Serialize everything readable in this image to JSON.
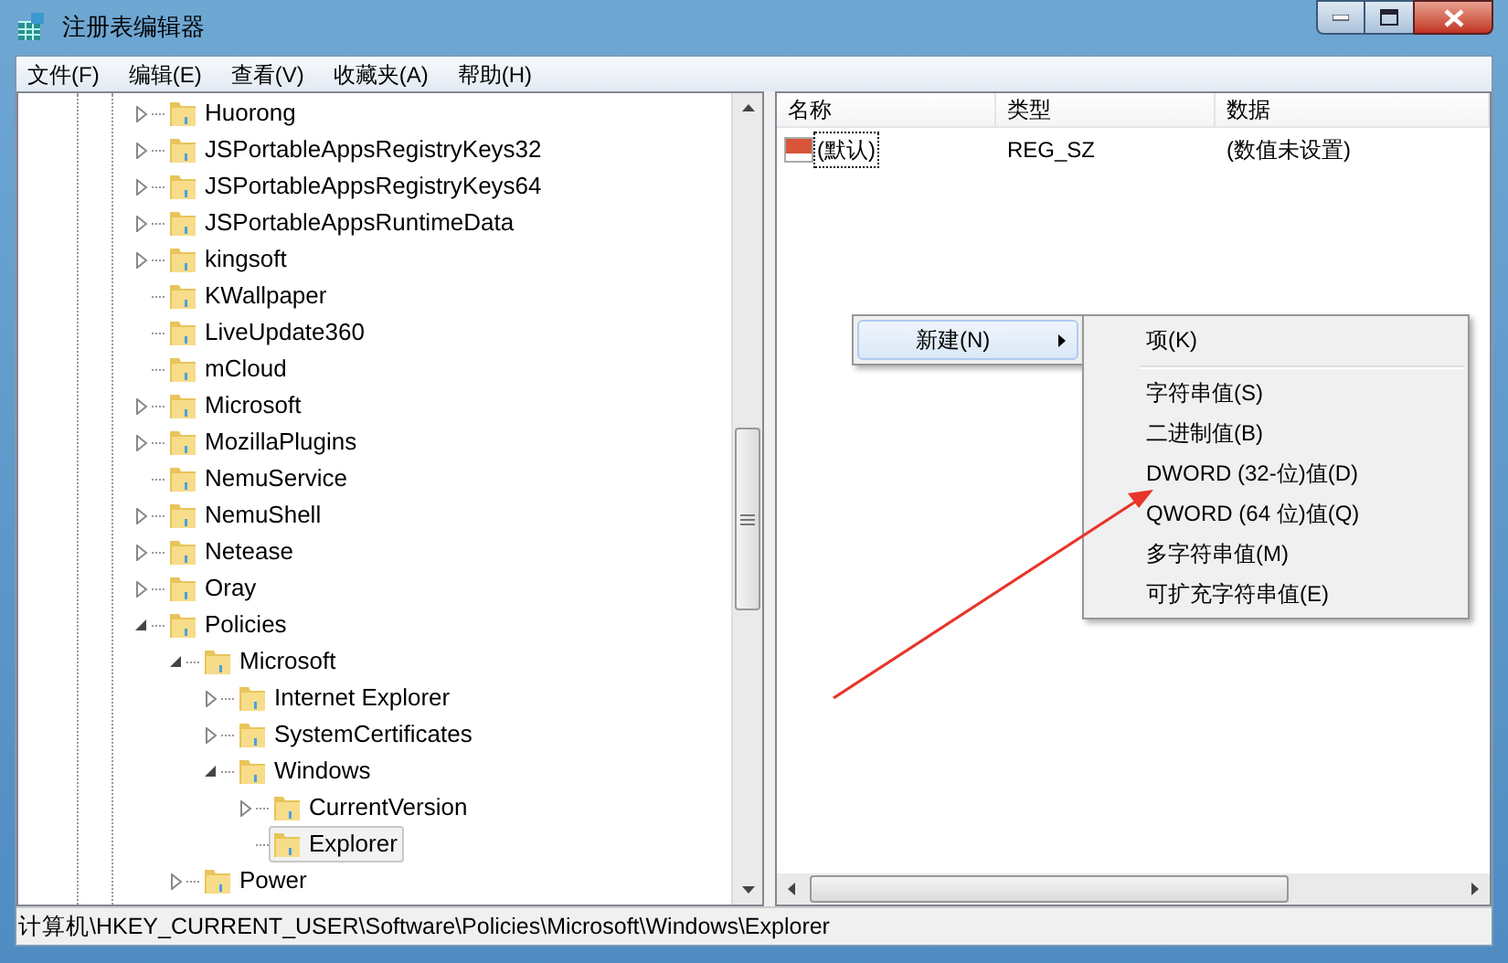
{
  "window": {
    "title": "注册表编辑器"
  },
  "menu_bar": [
    "文件(F)",
    "编辑(E)",
    "查看(V)",
    "收藏夹(A)",
    "帮助(H)"
  ],
  "tree": [
    {
      "label": "Huorong",
      "kind": "collapsed",
      "selected": false
    },
    {
      "label": "JSPortableAppsRegistryKeys32",
      "kind": "collapsed",
      "selected": false
    },
    {
      "label": "JSPortableAppsRegistryKeys64",
      "kind": "collapsed",
      "selected": false
    },
    {
      "label": "JSPortableAppsRuntimeData",
      "kind": "collapsed",
      "selected": false
    },
    {
      "label": "kingsoft",
      "kind": "collapsed",
      "selected": false
    },
    {
      "label": "KWallpaper",
      "kind": "leaf",
      "selected": false
    },
    {
      "label": "LiveUpdate360",
      "kind": "leaf",
      "selected": false
    },
    {
      "label": "mCloud",
      "kind": "leaf",
      "selected": false
    },
    {
      "label": "Microsoft",
      "kind": "collapsed",
      "selected": false
    },
    {
      "label": "MozillaPlugins",
      "kind": "collapsed",
      "selected": false
    },
    {
      "label": "NemuService",
      "kind": "leaf",
      "selected": false
    },
    {
      "label": "NemuShell",
      "kind": "collapsed",
      "selected": false
    },
    {
      "label": "Netease",
      "kind": "collapsed",
      "selected": false
    },
    {
      "label": "Oray",
      "kind": "collapsed",
      "selected": false
    },
    {
      "label": "Policies",
      "kind": "expanded",
      "selected": false,
      "children": [
        {
          "label": "Microsoft",
          "kind": "expanded",
          "selected": false,
          "children": [
            {
              "label": "Internet Explorer",
              "kind": "collapsed",
              "selected": false
            },
            {
              "label": "SystemCertificates",
              "kind": "collapsed",
              "selected": false
            },
            {
              "label": "Windows",
              "kind": "expanded",
              "selected": false,
              "children": [
                {
                  "label": "CurrentVersion",
                  "kind": "collapsed",
                  "selected": false
                },
                {
                  "label": "Explorer",
                  "kind": "leaf",
                  "selected": true
                }
              ]
            }
          ]
        },
        {
          "label": "Power",
          "kind": "collapsed",
          "selected": false
        }
      ]
    }
  ],
  "values_list": {
    "columns": [
      "名称",
      "类型",
      "数据"
    ],
    "rows": [
      {
        "name": "(默认)",
        "type": "REG_SZ",
        "data": "(数值未设置)",
        "focused": true
      }
    ]
  },
  "context_menu": {
    "items": [
      {
        "label": "新建(N)",
        "selected": true,
        "has_submenu": true
      }
    ]
  },
  "submenu": {
    "items": [
      {
        "kind": "item",
        "label": "项(K)"
      },
      {
        "kind": "separator"
      },
      {
        "kind": "item",
        "label": "字符串值(S)"
      },
      {
        "kind": "item",
        "label": "二进制值(B)"
      },
      {
        "kind": "item",
        "label": "DWORD (32-位)值(D)"
      },
      {
        "kind": "item",
        "label": "QWORD (64 位)值(Q)"
      },
      {
        "kind": "item",
        "label": "多字符串值(M)"
      },
      {
        "kind": "item",
        "label": "可扩充字符串值(E)"
      }
    ]
  },
  "status_bar": "计算机\\HKEY_CURRENT_USER\\Software\\Policies\\Microsoft\\Windows\\Explorer"
}
